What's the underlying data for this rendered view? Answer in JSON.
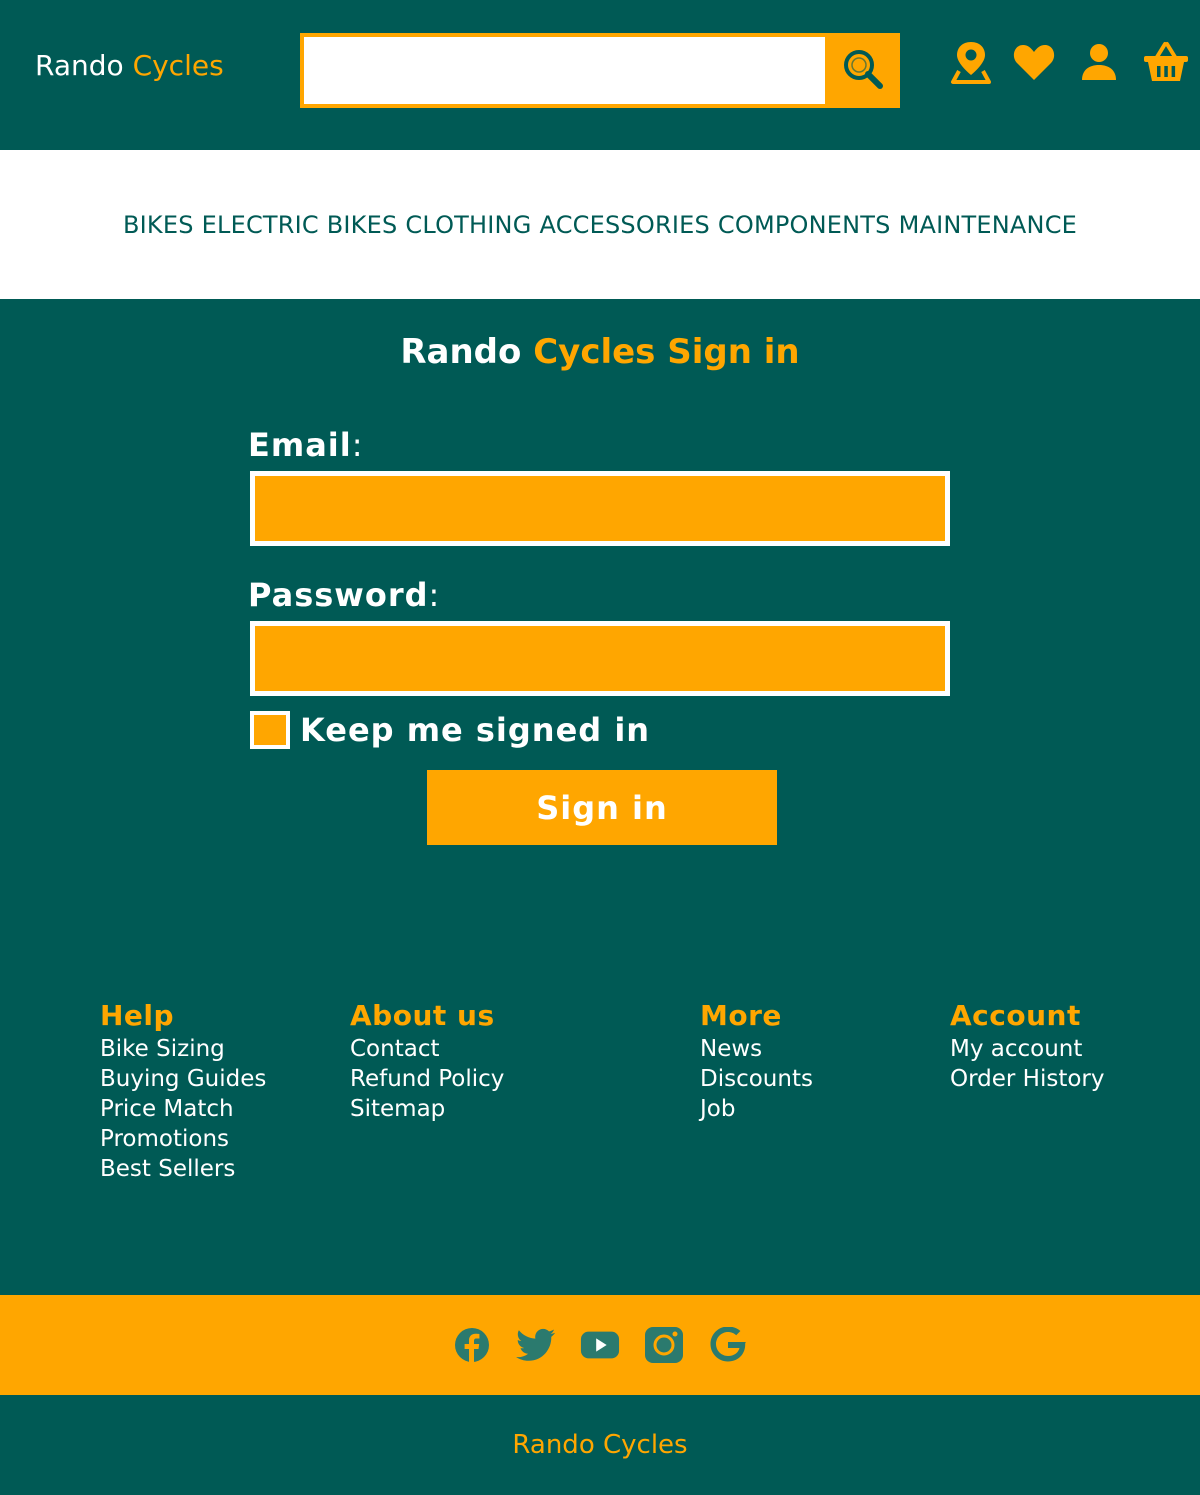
{
  "header": {
    "logo_part1": "Rando",
    "logo_part2": "Cycles",
    "search_placeholder": "",
    "icons": [
      "map-pin-icon",
      "heart-icon",
      "user-icon",
      "basket-icon"
    ]
  },
  "nav": {
    "items": [
      "BIKES",
      "ELECTRIC BIKES",
      "CLOTHING",
      "ACCESSORIES",
      "COMPONENTS",
      "MAINTENANCE"
    ]
  },
  "signin": {
    "title_part1": "Rando",
    "title_part2": "Cycles Sign in",
    "email_label": "Email",
    "password_label": "Password",
    "colon": ":",
    "keep_signed_in": "Keep me signed in",
    "button": "Sign in"
  },
  "footer": {
    "columns": [
      {
        "title": "Help",
        "links": [
          "Bike Sizing",
          "Buying Guides",
          "Price Match",
          "Promotions",
          "Best Sellers"
        ]
      },
      {
        "title": "About us",
        "links": [
          "Contact",
          "Refund Policy",
          "Sitemap"
        ]
      },
      {
        "title": "More",
        "links": [
          "News",
          "Discounts",
          "Job"
        ]
      },
      {
        "title": "Account",
        "links": [
          "My account",
          "Order History"
        ]
      }
    ],
    "social_icons": [
      "facebook-icon",
      "twitter-icon",
      "youtube-icon",
      "instagram-icon",
      "google-icon"
    ],
    "bottom_text": "Rando Cycles"
  },
  "colors": {
    "primary": "#005a55",
    "accent": "#ffa600",
    "white": "#ffffff"
  }
}
